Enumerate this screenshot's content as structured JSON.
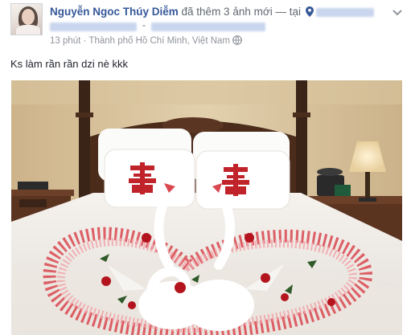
{
  "post": {
    "author_name": "Nguyễn Ngoc Thúy Diễm",
    "action_text": "đã thêm 3 ảnh mới — tại",
    "dash": "-",
    "time": "13 phút",
    "separator": "·",
    "location": "Thành phố Hồ Chí Minh, Việt Nam",
    "privacy_icon": "public-globe-icon",
    "body_text": "Ks làm rần rần dzi nè kkk"
  },
  "icons": {
    "location": "location-pin-icon",
    "menu": "chevron-down-icon"
  },
  "colors": {
    "author_link": "#365899",
    "meta_text": "#90949c",
    "body_text": "#1d2129"
  }
}
